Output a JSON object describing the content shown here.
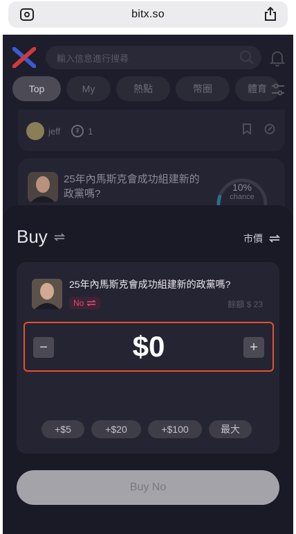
{
  "browser": {
    "url": "bitx.so"
  },
  "header": {
    "search_placeholder": "輸入信息進行搜尋"
  },
  "tabs": [
    {
      "label": "Top",
      "active": true
    },
    {
      "label": "My"
    },
    {
      "label": "熱點"
    },
    {
      "label": "幣圈"
    },
    {
      "label": "體育"
    }
  ],
  "feed": {
    "card1": {
      "user": "jeff",
      "count": "1"
    },
    "card2": {
      "question": "25年內馬斯克會成功組建新的政黨嗎?",
      "percent": "10%",
      "chance_label": "chance",
      "chance_fraction": 0.1
    }
  },
  "sheet": {
    "title": "Buy",
    "order_type": "市價",
    "market": {
      "question": "25年內馬斯克會成功組建新的政黨嗎?",
      "side": "No",
      "balance": "餘額 $ 23"
    },
    "amount": "$0",
    "minus": "−",
    "plus": "+",
    "quick": [
      "+$5",
      "+$20",
      "+$100",
      "最大"
    ],
    "submit": "Buy No"
  },
  "colors": {
    "accent_no": "#e04a78",
    "highlight_border": "#e2532c",
    "sheet_bg": "#1a1a26"
  }
}
